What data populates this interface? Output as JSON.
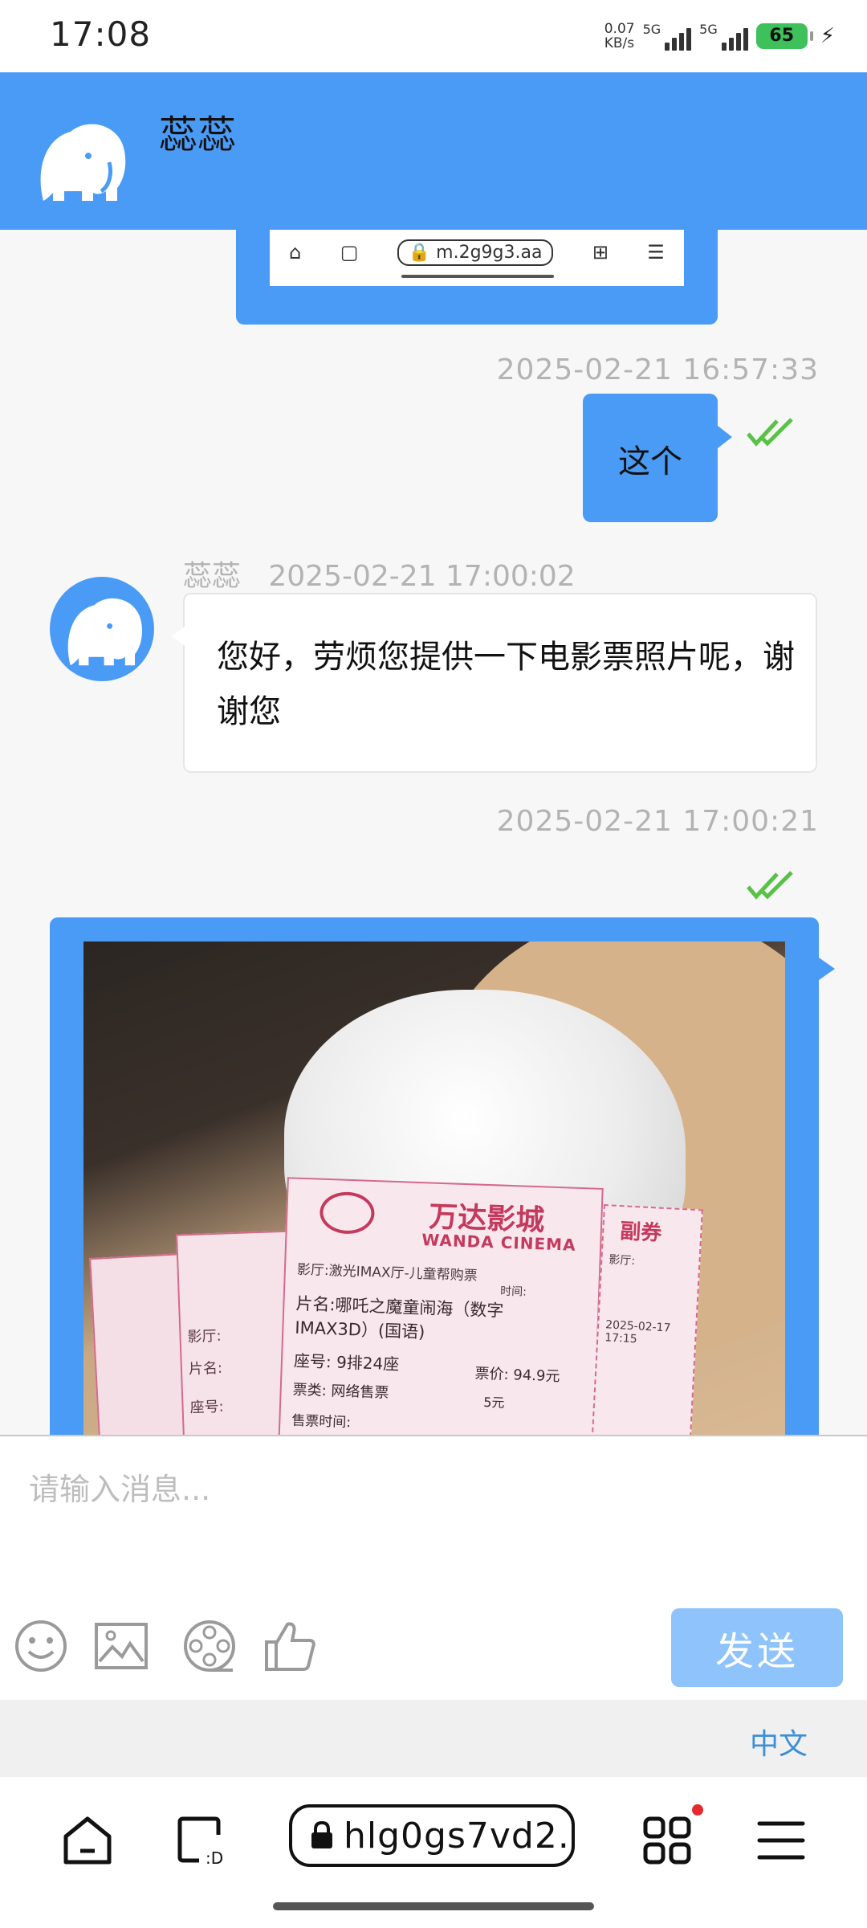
{
  "status_bar": {
    "time": "17:08",
    "net_speed_top": "0.07",
    "net_speed_bottom": "KB/s",
    "signal_label_1": "5G",
    "signal_label_2": "5G",
    "battery": "65"
  },
  "header": {
    "contact_name": "蕊蕊",
    "avatar": "elephant-icon"
  },
  "screenshot_bubble": {
    "url": "m.2g9g3.aa"
  },
  "messages": {
    "m1": {
      "timestamp": "2025-02-21 16:57:33",
      "text": "这个"
    },
    "m2": {
      "sender": "蕊蕊",
      "timestamp": "2025-02-21 17:00:02",
      "text": "您好，劳烦您提供一下电影票照片呢，谢谢您"
    },
    "m3": {
      "timestamp": "2025-02-21 17:00:21"
    }
  },
  "ticket_photo": {
    "brand_cn": "万达影城",
    "brand_en": "WANDA CINEMA",
    "stub_label": "副券",
    "hall": "激光IMAX厅-儿童帮购票",
    "movie": "哪吒之魔童闹海（数字IMAX3D）(国语)",
    "seat": "9排24座",
    "price": "94.9元",
    "service": "5元",
    "channel": "网络售票",
    "date": "2025-02-17 17:15",
    "labels": {
      "hall": "影厅:",
      "movie": "片名:",
      "seat": "座号:",
      "price": "票价:",
      "ticket_type": "票类:",
      "sale_time": "售票时间:",
      "time": "时间:"
    }
  },
  "composer": {
    "placeholder": "请输入消息...",
    "send_label": "发送",
    "tools": [
      "smile-icon",
      "image-icon",
      "film-reel-icon",
      "thumbs-up-icon"
    ]
  },
  "language": {
    "label": "中文"
  },
  "browser": {
    "url": "hlg0gs7vd2."
  },
  "colors": {
    "accent": "#4a9bf6",
    "send_button": "#8ec3fb",
    "check": "#58c246",
    "timestamp": "#b3b3b3"
  }
}
